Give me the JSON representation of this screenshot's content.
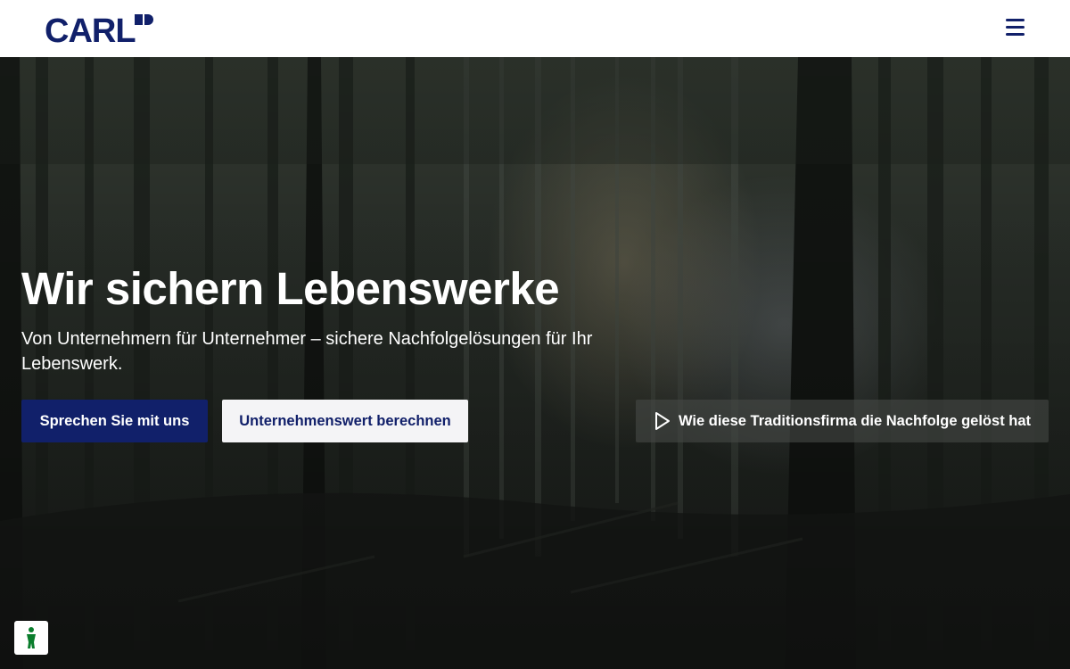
{
  "header": {
    "logo_text": "CARL",
    "menu_icon": "hamburger-menu-icon"
  },
  "hero": {
    "background": "dark forest photograph",
    "title": "Wir sichern Lebenswerke",
    "subtitle": "Von Unternehmern für Unternehmer – sichere Nachfolgelösungen für Ihr Lebenswerk.",
    "cta_primary": "Sprechen Sie mit uns",
    "cta_secondary": "Unternehmenswert berechnen",
    "video_link": "Wie diese Traditionsfirma die Nachfolge gelöst hat",
    "video_icon": "play-icon"
  },
  "consent": {
    "icon": "accessibility-person-icon"
  },
  "colors": {
    "brand_navy": "#11206a",
    "header_bg": "#ffffff",
    "secondary_button_bg": "#f4f4f6",
    "consent_icon_green": "#0a7d2c"
  }
}
